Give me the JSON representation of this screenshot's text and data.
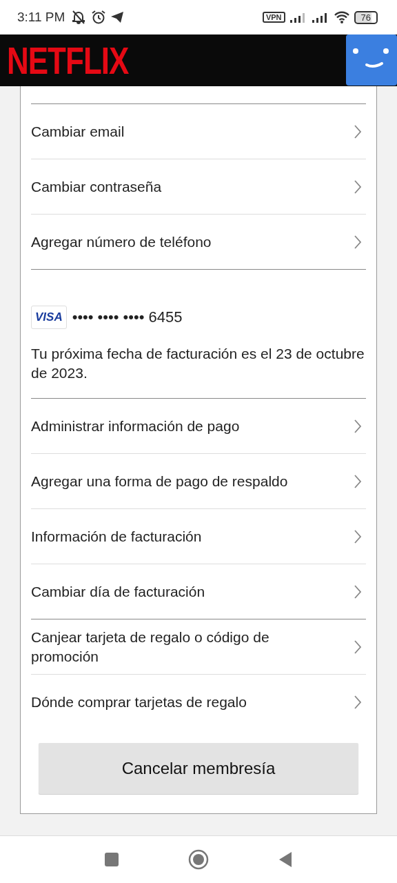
{
  "status_bar": {
    "time": "3:11 PM",
    "vpn": "VPN",
    "battery": "76"
  },
  "header": {
    "logo": "NETFLIX"
  },
  "sections": [
    {
      "kind": "links",
      "items": [
        "Cambiar email",
        "Cambiar contraseña",
        "Agregar número de teléfono"
      ]
    },
    {
      "kind": "payment",
      "card_brand": "VISA",
      "card_number": "•••• •••• •••• 6455",
      "note": "Tu próxima fecha de facturación es el 23 de octubre de 2023."
    },
    {
      "kind": "links",
      "items": [
        "Administrar información de pago",
        "Agregar una forma de pago de respaldo",
        "Información de facturación",
        "Cambiar día de facturación"
      ]
    },
    {
      "kind": "links",
      "items": [
        "Canjear tarjeta de regalo o código de promoción",
        "Dónde comprar tarjetas de regalo"
      ]
    }
  ],
  "cancel_button": "Cancelar membresía"
}
